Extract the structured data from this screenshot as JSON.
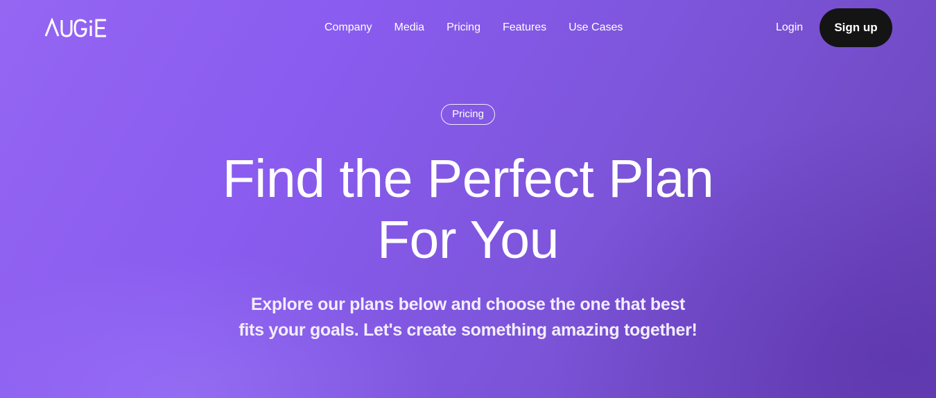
{
  "nav": {
    "logo": "AUGiE",
    "links": [
      "Company",
      "Media",
      "Pricing",
      "Features",
      "Use Cases"
    ],
    "login_label": "Login",
    "signup_label": "Sign up"
  },
  "hero": {
    "badge": "Pricing",
    "headline_line1": "Find the Perfect Plan",
    "headline_line2": "For You",
    "subtitle_line1": "Explore our plans below and choose the one that best",
    "subtitle_line2": "fits your goals. Let's create something amazing together!"
  },
  "colors": {
    "background_start": "#9566f2",
    "background_end": "#6a44b8",
    "signup_button": "#141414",
    "text": "#ffffff"
  }
}
